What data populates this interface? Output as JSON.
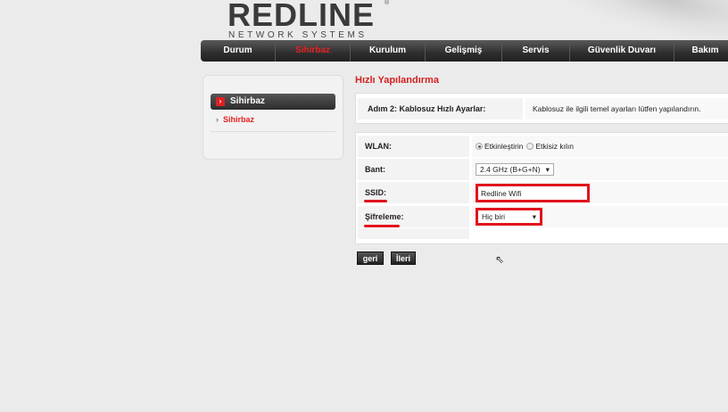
{
  "brand": {
    "name": "REDLINE",
    "tagline": "NETWORK SYSTEMS",
    "mark": "®"
  },
  "nav": [
    {
      "label": "Durum"
    },
    {
      "label": "Sihirbaz",
      "active": true
    },
    {
      "label": "Kurulum"
    },
    {
      "label": "Gelişmiş"
    },
    {
      "label": "Servis"
    },
    {
      "label": "Güvenlik Duvarı"
    },
    {
      "label": "Bakım"
    }
  ],
  "sidebar": {
    "header": "Sihirbaz",
    "header_icon": "chevron-right-icon",
    "items": [
      {
        "label": "Sihirbaz"
      }
    ]
  },
  "page_title": "Hızlı Yapılandırma",
  "step": {
    "label": "Adım 2: Kablosuz Hızlı Ayarlar:",
    "description": "Kablosuz ile ilgili temel ayarları lütfen yapılandırın."
  },
  "form": {
    "wlan": {
      "label": "WLAN:",
      "options": [
        "Etkinleştirin",
        "Etkisiz kılın"
      ],
      "selected": "Etkinleştirin"
    },
    "band": {
      "label": "Bant:",
      "value": "2.4 GHz (B+G+N)"
    },
    "ssid": {
      "label": "SSID:",
      "value": "Redline Wifi"
    },
    "encryption": {
      "label": "Şifreleme:",
      "value": "Hiç biri"
    }
  },
  "buttons": {
    "back": "geri",
    "next": "İleri"
  },
  "colors": {
    "accent": "#e1141c",
    "nav": "#2e2e2e"
  }
}
